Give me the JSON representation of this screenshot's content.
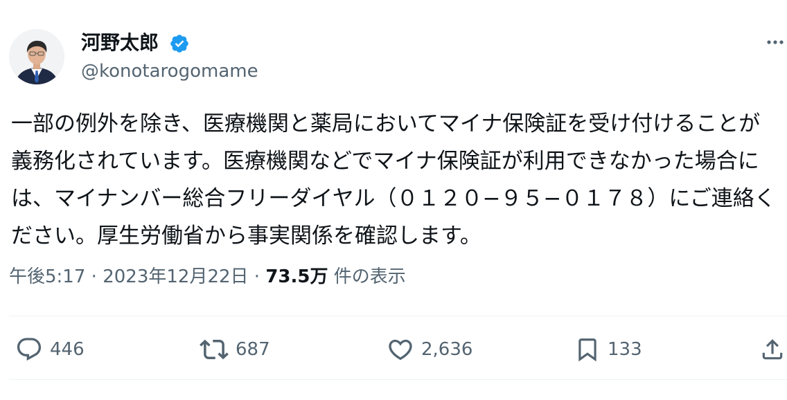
{
  "author": {
    "display_name": "河野太郎",
    "handle": "@konotarogomame",
    "verified": true
  },
  "tweet": {
    "text": "一部の例外を除き、医療機関と薬局においてマイナ保険証を受け付けることが義務化されています。医療機関などでマイナ保険証が利用できなかった場合には、マイナンバー総合フリーダイヤル（０１２０−９５−０１７８）にご連絡ください。厚生労働省から事実関係を確認します。"
  },
  "meta": {
    "time": "午後5:17",
    "separator1": " · ",
    "date": "2023年12月22日",
    "separator2": " · ",
    "views_count": "73.5万",
    "views_label": " 件の表示"
  },
  "actions": {
    "reply_count": "446",
    "repost_count": "687",
    "like_count": "2,636",
    "bookmark_count": "133"
  },
  "icons": {
    "verified": "verified-badge-icon",
    "more": "more-horizontal-icon",
    "reply": "reply-icon",
    "repost": "repost-icon",
    "like": "heart-icon",
    "bookmark": "bookmark-icon",
    "share": "share-icon"
  },
  "colors": {
    "verified_blue": "#1d9bf0",
    "secondary_text": "#536471",
    "primary_text": "#0f1419",
    "divider": "#eff3f4"
  }
}
